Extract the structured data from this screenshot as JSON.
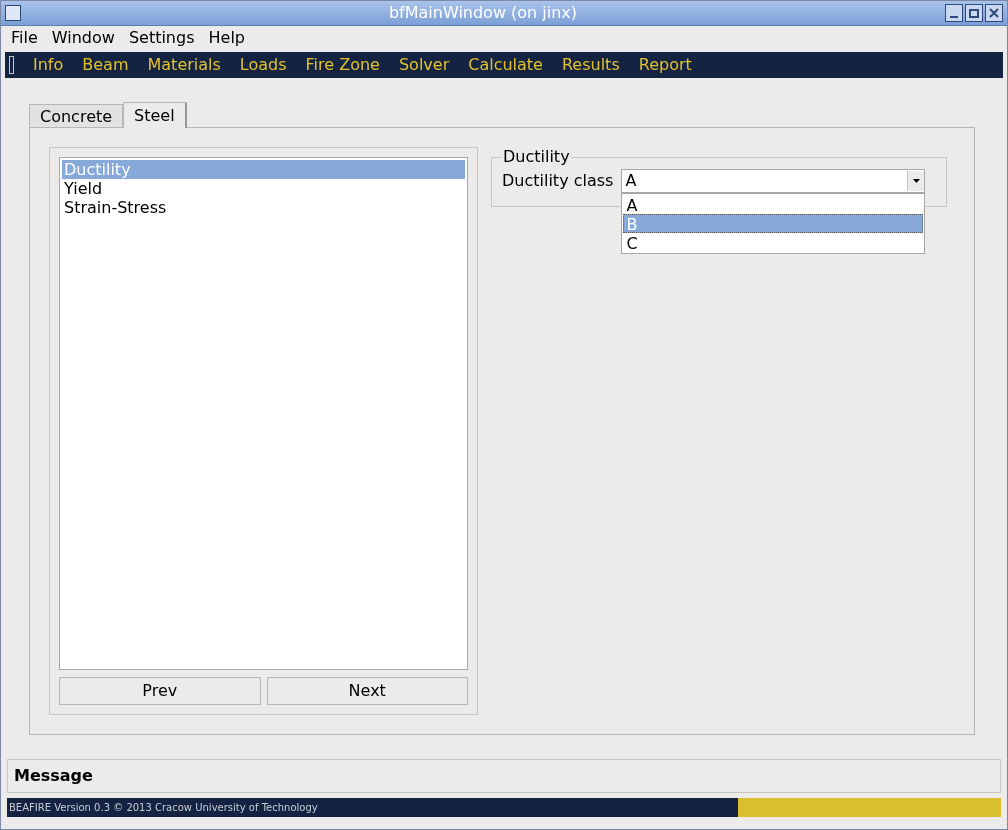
{
  "window": {
    "title": "bfMainWindow (on jinx)"
  },
  "menu": [
    "File",
    "Window",
    "Settings",
    "Help"
  ],
  "toolbar": [
    "Info",
    "Beam",
    "Materials",
    "Loads",
    "Fire Zone",
    "Solver",
    "Calculate",
    "Results",
    "Report"
  ],
  "tabs": [
    {
      "label": "Concrete",
      "selected": false
    },
    {
      "label": "Steel",
      "selected": true
    }
  ],
  "list": [
    {
      "label": "Ductility",
      "selected": true
    },
    {
      "label": "Yield",
      "selected": false
    },
    {
      "label": "Strain-Stress",
      "selected": false
    }
  ],
  "buttons": [
    "Prev",
    "Next"
  ],
  "group": {
    "title": "Ductility",
    "field_label": "Ductility class",
    "value": "A",
    "options": [
      {
        "label": "A",
        "highlighted": false
      },
      {
        "label": "B",
        "highlighted": true
      },
      {
        "label": "C",
        "highlighted": false
      }
    ]
  },
  "message": {
    "title": "Message"
  },
  "status_bar": {
    "text": "BEAFIRE Version 0.3 © 2013 Cracow University of Technology"
  }
}
